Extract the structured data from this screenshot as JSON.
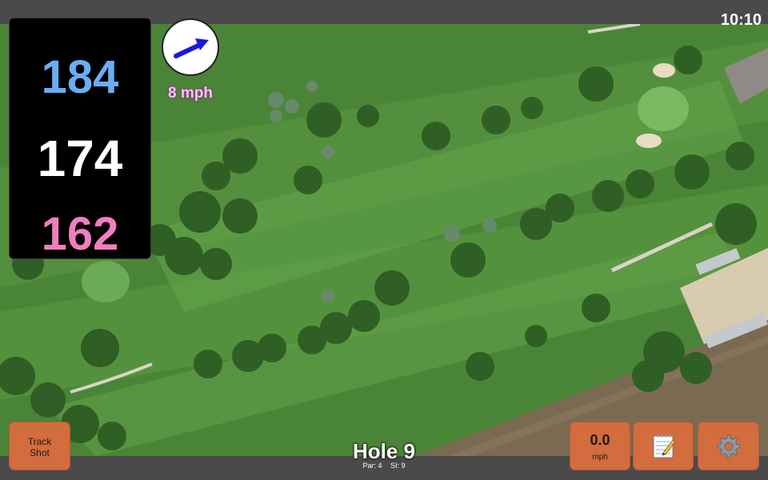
{
  "status_bar": {
    "time": "10:10"
  },
  "distances": {
    "back": {
      "value": "184",
      "color": "#6aaef3"
    },
    "middle": {
      "value": "174",
      "color": "#ffffff"
    },
    "front": {
      "value": "162",
      "color": "#f07fbd"
    }
  },
  "wind": {
    "speed_label": "8 mph",
    "icon": "wind-direction-arrow-icon",
    "arrow_color": "#1a1adb"
  },
  "buttons": {
    "track_shot": {
      "line1": "Track",
      "line2": "Shot"
    },
    "speed": {
      "value": "0.0",
      "unit": "mph"
    },
    "notes": {
      "icon": "notepad-icon"
    },
    "settings": {
      "icon": "gear-icon"
    }
  },
  "hole": {
    "title": "Hole 9",
    "par_label": "Par: 4",
    "si_label": "SI: 9"
  },
  "colors": {
    "button_bg": "#d36c3e",
    "fairway": "#4f8a3a",
    "bar": "#4a4a4a"
  }
}
